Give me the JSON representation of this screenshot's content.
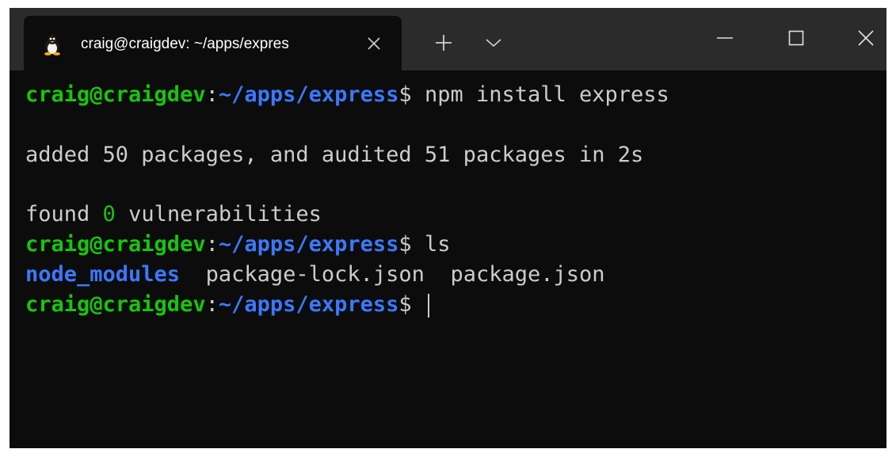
{
  "tab": {
    "title": "craig@craigdev: ~/apps/expres",
    "icon": "linux-penguin-icon"
  },
  "titlebar": {
    "new_tab_icon": "plus-icon",
    "dropdown_icon": "chevron-down-icon",
    "minimize_icon": "minimize-icon",
    "maximize_icon": "maximize-icon",
    "close_icon": "close-icon"
  },
  "colors": {
    "prompt_user": "#16c60c",
    "prompt_path": "#3b78ff",
    "text": "#cccccc",
    "background": "#0c0c0c",
    "titlebar": "#2b2b2b"
  },
  "terminal": {
    "prompt": {
      "user_host": "craig@craigdev",
      "colon": ":",
      "path": "~/apps/express",
      "symbol": "$"
    },
    "cmd1": " npm install express",
    "out1": "added 50 packages, and audited 51 packages in 2s",
    "out2_prefix": "found ",
    "out2_count": "0",
    "out2_suffix": " vulnerabilities",
    "cmd2": " ls",
    "ls": {
      "dir": "node_modules",
      "sep1": "  ",
      "file1": "package-lock.json",
      "sep2": "  ",
      "file2": "package.json"
    },
    "cmd3": " "
  }
}
